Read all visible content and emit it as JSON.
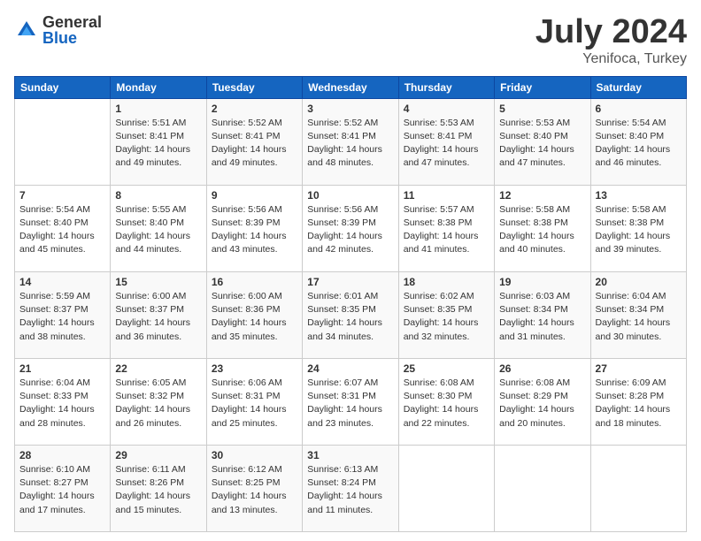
{
  "logo": {
    "general": "General",
    "blue": "Blue"
  },
  "header": {
    "month": "July 2024",
    "location": "Yenifoca, Turkey"
  },
  "days_of_week": [
    "Sunday",
    "Monday",
    "Tuesday",
    "Wednesday",
    "Thursday",
    "Friday",
    "Saturday"
  ],
  "weeks": [
    [
      {
        "day": "",
        "info": ""
      },
      {
        "day": "1",
        "info": "Sunrise: 5:51 AM\nSunset: 8:41 PM\nDaylight: 14 hours\nand 49 minutes."
      },
      {
        "day": "2",
        "info": "Sunrise: 5:52 AM\nSunset: 8:41 PM\nDaylight: 14 hours\nand 49 minutes."
      },
      {
        "day": "3",
        "info": "Sunrise: 5:52 AM\nSunset: 8:41 PM\nDaylight: 14 hours\nand 48 minutes."
      },
      {
        "day": "4",
        "info": "Sunrise: 5:53 AM\nSunset: 8:41 PM\nDaylight: 14 hours\nand 47 minutes."
      },
      {
        "day": "5",
        "info": "Sunrise: 5:53 AM\nSunset: 8:40 PM\nDaylight: 14 hours\nand 47 minutes."
      },
      {
        "day": "6",
        "info": "Sunrise: 5:54 AM\nSunset: 8:40 PM\nDaylight: 14 hours\nand 46 minutes."
      }
    ],
    [
      {
        "day": "7",
        "info": "Sunrise: 5:54 AM\nSunset: 8:40 PM\nDaylight: 14 hours\nand 45 minutes."
      },
      {
        "day": "8",
        "info": "Sunrise: 5:55 AM\nSunset: 8:40 PM\nDaylight: 14 hours\nand 44 minutes."
      },
      {
        "day": "9",
        "info": "Sunrise: 5:56 AM\nSunset: 8:39 PM\nDaylight: 14 hours\nand 43 minutes."
      },
      {
        "day": "10",
        "info": "Sunrise: 5:56 AM\nSunset: 8:39 PM\nDaylight: 14 hours\nand 42 minutes."
      },
      {
        "day": "11",
        "info": "Sunrise: 5:57 AM\nSunset: 8:38 PM\nDaylight: 14 hours\nand 41 minutes."
      },
      {
        "day": "12",
        "info": "Sunrise: 5:58 AM\nSunset: 8:38 PM\nDaylight: 14 hours\nand 40 minutes."
      },
      {
        "day": "13",
        "info": "Sunrise: 5:58 AM\nSunset: 8:38 PM\nDaylight: 14 hours\nand 39 minutes."
      }
    ],
    [
      {
        "day": "14",
        "info": "Sunrise: 5:59 AM\nSunset: 8:37 PM\nDaylight: 14 hours\nand 38 minutes."
      },
      {
        "day": "15",
        "info": "Sunrise: 6:00 AM\nSunset: 8:37 PM\nDaylight: 14 hours\nand 36 minutes."
      },
      {
        "day": "16",
        "info": "Sunrise: 6:00 AM\nSunset: 8:36 PM\nDaylight: 14 hours\nand 35 minutes."
      },
      {
        "day": "17",
        "info": "Sunrise: 6:01 AM\nSunset: 8:35 PM\nDaylight: 14 hours\nand 34 minutes."
      },
      {
        "day": "18",
        "info": "Sunrise: 6:02 AM\nSunset: 8:35 PM\nDaylight: 14 hours\nand 32 minutes."
      },
      {
        "day": "19",
        "info": "Sunrise: 6:03 AM\nSunset: 8:34 PM\nDaylight: 14 hours\nand 31 minutes."
      },
      {
        "day": "20",
        "info": "Sunrise: 6:04 AM\nSunset: 8:34 PM\nDaylight: 14 hours\nand 30 minutes."
      }
    ],
    [
      {
        "day": "21",
        "info": "Sunrise: 6:04 AM\nSunset: 8:33 PM\nDaylight: 14 hours\nand 28 minutes."
      },
      {
        "day": "22",
        "info": "Sunrise: 6:05 AM\nSunset: 8:32 PM\nDaylight: 14 hours\nand 26 minutes."
      },
      {
        "day": "23",
        "info": "Sunrise: 6:06 AM\nSunset: 8:31 PM\nDaylight: 14 hours\nand 25 minutes."
      },
      {
        "day": "24",
        "info": "Sunrise: 6:07 AM\nSunset: 8:31 PM\nDaylight: 14 hours\nand 23 minutes."
      },
      {
        "day": "25",
        "info": "Sunrise: 6:08 AM\nSunset: 8:30 PM\nDaylight: 14 hours\nand 22 minutes."
      },
      {
        "day": "26",
        "info": "Sunrise: 6:08 AM\nSunset: 8:29 PM\nDaylight: 14 hours\nand 20 minutes."
      },
      {
        "day": "27",
        "info": "Sunrise: 6:09 AM\nSunset: 8:28 PM\nDaylight: 14 hours\nand 18 minutes."
      }
    ],
    [
      {
        "day": "28",
        "info": "Sunrise: 6:10 AM\nSunset: 8:27 PM\nDaylight: 14 hours\nand 17 minutes."
      },
      {
        "day": "29",
        "info": "Sunrise: 6:11 AM\nSunset: 8:26 PM\nDaylight: 14 hours\nand 15 minutes."
      },
      {
        "day": "30",
        "info": "Sunrise: 6:12 AM\nSunset: 8:25 PM\nDaylight: 14 hours\nand 13 minutes."
      },
      {
        "day": "31",
        "info": "Sunrise: 6:13 AM\nSunset: 8:24 PM\nDaylight: 14 hours\nand 11 minutes."
      },
      {
        "day": "",
        "info": ""
      },
      {
        "day": "",
        "info": ""
      },
      {
        "day": "",
        "info": ""
      }
    ]
  ]
}
